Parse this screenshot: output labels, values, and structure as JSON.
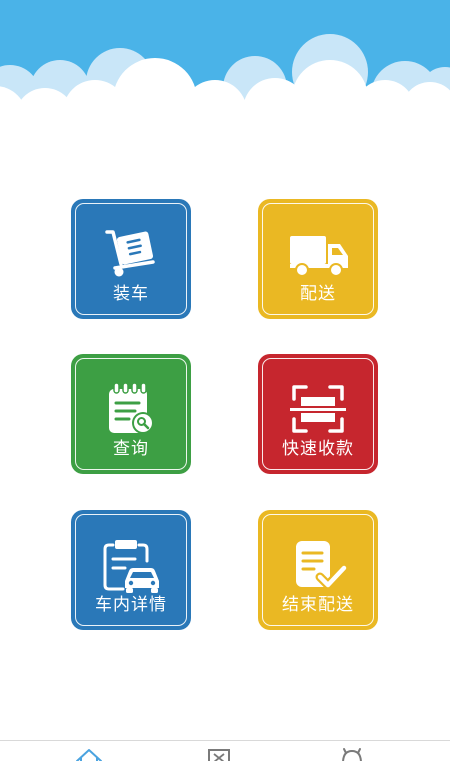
{
  "colors": {
    "sky": "#4ab3e8",
    "cloud": "#ffffff",
    "cloud_shadow": "#c9e6f8",
    "blue_tile": "#2a78b8",
    "yellow_tile": "#eab823",
    "green_tile": "#3d9f44",
    "red_tile": "#c6262e",
    "nav_active": "#4aa3e0",
    "nav_inactive": "#7a7a7a"
  },
  "menu": {
    "load": {
      "label": "装车",
      "icon": "cart-icon"
    },
    "deliver": {
      "label": "配送",
      "icon": "truck-icon"
    },
    "query": {
      "label": "查询",
      "icon": "notebook-search-icon"
    },
    "quick_pay": {
      "label": "快速收款",
      "icon": "scan-icon"
    },
    "vehicle_detail": {
      "label": "车内详情",
      "icon": "clipboard-car-icon"
    },
    "end_delivery": {
      "label": "结束配送",
      "icon": "document-check-icon"
    }
  },
  "bottom_nav": {
    "items": [
      {
        "icon": "home-icon",
        "active": true
      },
      {
        "icon": "box-icon",
        "active": false
      },
      {
        "icon": "user-icon",
        "active": false
      }
    ]
  }
}
